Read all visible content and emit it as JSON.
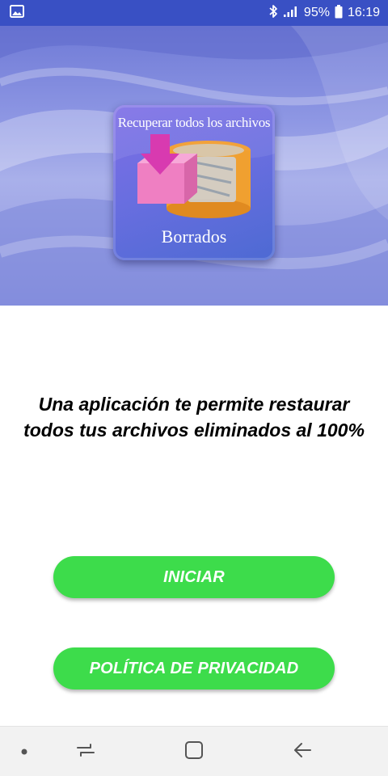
{
  "status_bar": {
    "battery": "95%",
    "time": "16:19",
    "icons": [
      "image-notification-icon",
      "bluetooth-icon",
      "signal-icon",
      "battery-icon"
    ]
  },
  "hero": {
    "icon_top_text": "Recuperar todos los archivos",
    "icon_bottom_text": "Borrados"
  },
  "headline": {
    "line1": "Una aplicación te permite restaurar",
    "line2": "todos tus archivos eliminados al 100%"
  },
  "buttons": {
    "start_label": "INICIAR",
    "privacy_label": "POLÍTICA DE PRIVACIDAD"
  },
  "nav": {
    "icons": [
      "dot-icon",
      "recent-apps-icon",
      "home-icon",
      "back-icon"
    ]
  },
  "colors": {
    "status_bar": "#3950c4",
    "button": "#3ddc4b",
    "nav_bar": "#f2f2f2"
  }
}
